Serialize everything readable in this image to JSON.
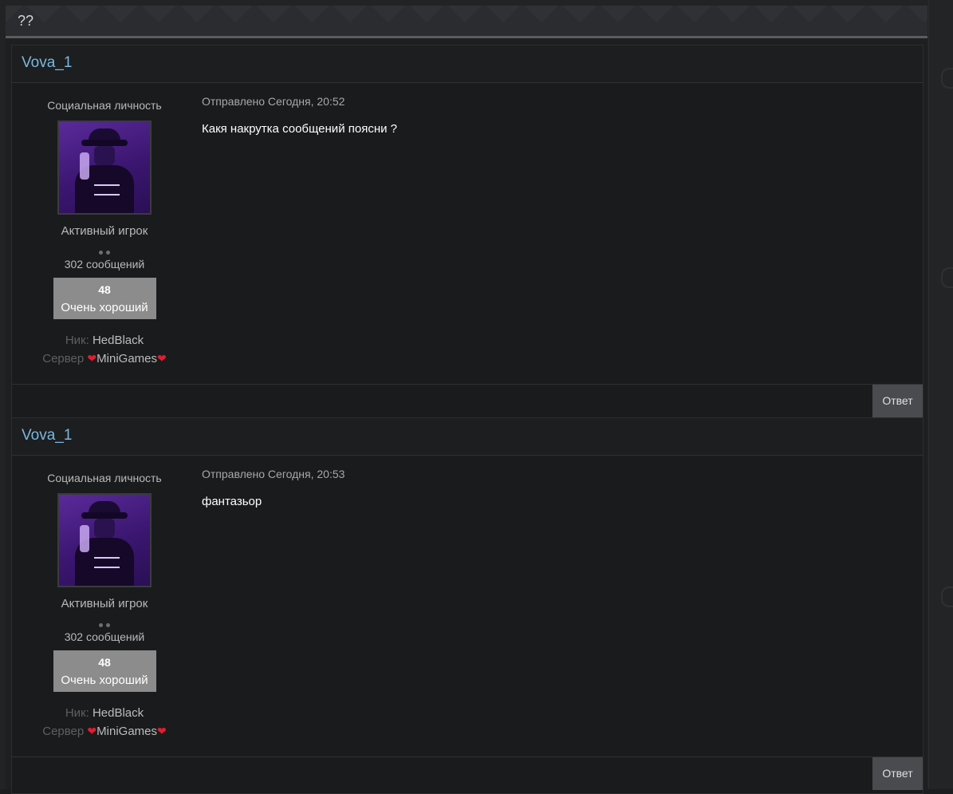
{
  "topic": {
    "title": "??"
  },
  "posts": [
    {
      "author": "Vova_1",
      "rank": "Социальная личность",
      "avatar_icon": "user-avatar-image",
      "group": "Активный игрок",
      "post_count": "302 сообщений",
      "reputation": {
        "value": "48",
        "label": "Очень хороший"
      },
      "fields": {
        "nick_label": "Ник:",
        "nick_value": "HedBlack",
        "server_label": "Сервер",
        "server_value": "MiniGames"
      },
      "posted": "Отправлено Сегодня, 20:52",
      "content": "Какя накрутка сообщений поясни ?",
      "reply_label": "Ответ"
    },
    {
      "author": "Vova_1",
      "rank": "Социальная личность",
      "avatar_icon": "user-avatar-image",
      "group": "Активный игрок",
      "post_count": "302 сообщений",
      "reputation": {
        "value": "48",
        "label": "Очень хороший"
      },
      "fields": {
        "nick_label": "Ник:",
        "nick_value": "HedBlack",
        "server_label": "Сервер",
        "server_value": "MiniGames"
      },
      "posted": "Отправлено Сегодня, 20:53",
      "content": "фантазьор",
      "reply_label": "Ответ"
    }
  ],
  "colors": {
    "author_link": "#79b8de",
    "reputation_bg": "#8c8c8c",
    "heart": "#e31d2e",
    "reply_button": "#4a4b4e"
  }
}
